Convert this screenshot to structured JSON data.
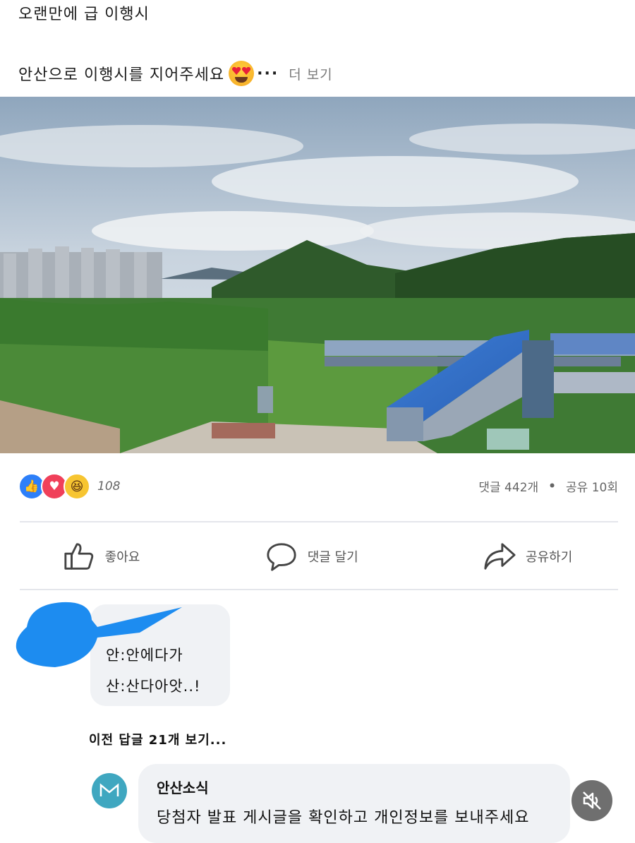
{
  "post": {
    "line1": "오랜만에 급 이행시",
    "line2": "안산으로 이행시를 지어주세요",
    "ellipsis": "···",
    "more": "더 보기"
  },
  "reactions": {
    "icons": [
      "like-icon",
      "love-icon",
      "haha-icon"
    ],
    "count": "108"
  },
  "stats": {
    "comments": "댓글 442개",
    "separator": "•",
    "shares": "공유 10회"
  },
  "actions": {
    "like": "좋아요",
    "comment": "댓글 달기",
    "share": "공유하기"
  },
  "comment": {
    "line1": "안:안에다가",
    "line2": "산:산다아앗..!"
  },
  "prev_replies": "이전 답글 21개 보기...",
  "reply": {
    "author": "안산소식",
    "text": "당첨자 발표 게시글을 확인하고 개인정보를 보내주세요"
  },
  "colors": {
    "like": "#2d7ff9",
    "love": "#f0405a",
    "haha": "#f7c531",
    "bubble": "#f0f2f5",
    "avatar": "#3fa7c0",
    "redaction": "#1d8cf0"
  }
}
